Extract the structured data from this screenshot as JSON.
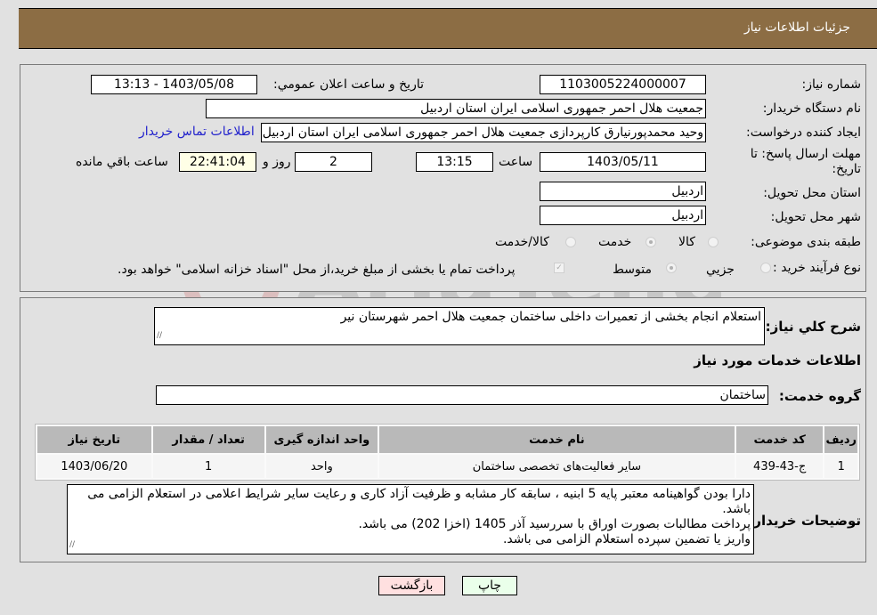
{
  "header": {
    "title": "جزئیات اطلاعات نیاز"
  },
  "details": {
    "need_number": {
      "label": "شماره نیاز:",
      "value": "1103005224000007"
    },
    "announce_datetime": {
      "label": "تاریخ و ساعت اعلان عمومي:",
      "value": "1403/05/08 - 13:13"
    },
    "buyer_org": {
      "label": "نام دستگاه خریدار:",
      "value": "جمعیت هلال احمر جمهوری اسلامی ایران استان اردبیل"
    },
    "requester": {
      "label": "ایجاد کننده درخواست:",
      "value": "وحید محمدپورنیارق کارپردازی جمعیت هلال احمر جمهوری اسلامی ایران استان اردبیل"
    },
    "buyer_contact_link": "اطلاعات تماس خریدار",
    "deadline": {
      "label": "مهلت ارسال پاسخ: تا تاریخ:",
      "date": "1403/05/11",
      "time_label": "ساعت",
      "time": "13:15",
      "days": "2",
      "days_label": "روز و",
      "remaining": "22:41:04",
      "remaining_label": "ساعت باقي مانده"
    },
    "province": {
      "label": "استان محل تحویل:",
      "value": "اردبیل"
    },
    "city": {
      "label": "شهر محل تحویل:",
      "value": "اردبیل"
    },
    "category": {
      "label": "طبقه بندی موضوعی:",
      "options": [
        "کالا",
        "خدمت",
        "کالا/خدمت"
      ],
      "selected": "خدمت"
    },
    "purchase_type": {
      "label": "نوع فرآیند خرید :",
      "options": [
        "جزيي",
        "متوسط"
      ],
      "selected": "متوسط",
      "treasury_note": "پرداخت تمام یا بخشی از مبلغ خرید،از محل \"اسناد خزانه اسلامی\" خواهد بود."
    }
  },
  "summary": {
    "label": "شرح کلي نیاز:",
    "value": "استعلام انجام بخشی از تعمیرات داخلی ساختمان جمعیت هلال احمر شهرستان نیر"
  },
  "services_section_title": "اطلاعات خدمات مورد نیاز",
  "service_group": {
    "label": "گروه خدمت:",
    "value": "ساختمان"
  },
  "table": {
    "headers": [
      "ردیف",
      "کد خدمت",
      "نام خدمت",
      "واحد اندازه گیری",
      "تعداد / مقدار",
      "تاریخ نیاز"
    ],
    "rows": [
      [
        "1",
        "ج-43-439",
        "سایر فعالیت‌های تخصصی ساختمان",
        "واحد",
        "1",
        "1403/06/20"
      ]
    ]
  },
  "buyer_notes": {
    "label": "توضیحات خریدار:",
    "lines": [
      "دارا بودن گواهینامه معتبر پایه 5 ابنیه ، سابقه کار مشابه و ظرفیت آزاد کاری و رعایت سایر شرایط اعلامی در استعلام الزامی می باشد.",
      "پرداخت مطالبات بصورت اوراق با سررسید آذر 1405 (اخزا 202) می باشد.",
      "واریز یا تضمین سپرده استعلام الزامی می باشد."
    ]
  },
  "buttons": {
    "print": "چاپ",
    "back": "بازگشت"
  },
  "watermark": {
    "text": "AriaTender.neT"
  }
}
